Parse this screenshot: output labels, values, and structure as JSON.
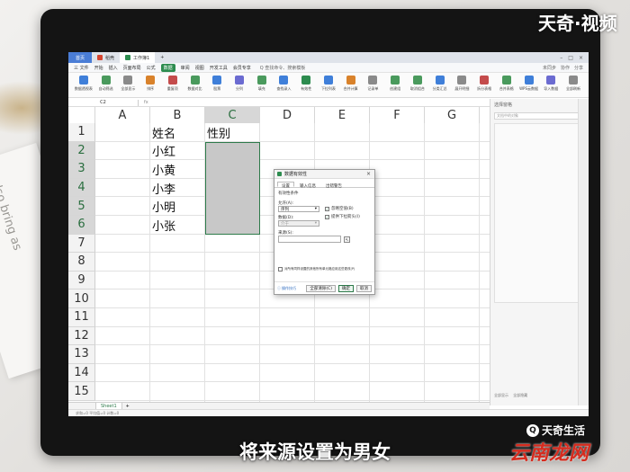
{
  "watermark": "天奇·视频",
  "subtitle": "将来源设置为男女",
  "brand_small": "天奇生活",
  "brand_small_logo": "Q",
  "brand_large": "云南龙网",
  "background_book_text": "also bring as",
  "tabs": {
    "home": "首页",
    "items": [
      "稻壳",
      "工作簿1"
    ],
    "add": "+"
  },
  "menu": {
    "file": "三 文件",
    "items": [
      "开始",
      "插入",
      "页面布局",
      "公式",
      "数据",
      "审阅",
      "视图",
      "开发工具",
      "会员专享"
    ],
    "active": "数据",
    "search": "Q 查找命令、搜索模板",
    "right": [
      "未同步",
      "协作",
      "分享"
    ]
  },
  "ribbon": [
    {
      "label": "数据透视表",
      "color": "#3f7fd9"
    },
    {
      "label": "自动筛选",
      "color": "#4a9a5d"
    },
    {
      "label": "全部显示",
      "color": "#8a8a8a"
    },
    {
      "label": "排序",
      "color": "#d9822b"
    },
    {
      "label": "重复项",
      "color": "#c44b4b"
    },
    {
      "label": "数据对比",
      "color": "#4a9a5d"
    },
    {
      "label": "股票",
      "color": "#3f7fd9"
    },
    {
      "label": "分列",
      "color": "#6b6bd1"
    },
    {
      "label": "填充",
      "color": "#4a9a5d"
    },
    {
      "label": "查找录入",
      "color": "#3f7fd9"
    },
    {
      "label": "有效性",
      "color": "#2d8c4f"
    },
    {
      "label": "下拉列表",
      "color": "#3f7fd9"
    },
    {
      "label": "合并计算",
      "color": "#d9822b"
    },
    {
      "label": "记录单",
      "color": "#8a8a8a"
    },
    {
      "label": "创建组",
      "color": "#4a9a5d"
    },
    {
      "label": "取消组合",
      "color": "#4a9a5d"
    },
    {
      "label": "分类汇总",
      "color": "#3f7fd9"
    },
    {
      "label": "展开明细",
      "color": "#8a8a8a"
    },
    {
      "label": "拆分表格",
      "color": "#c44b4b"
    },
    {
      "label": "合并表格",
      "color": "#4a9a5d"
    },
    {
      "label": "WPS云数据",
      "color": "#3f7fd9"
    },
    {
      "label": "导入数据",
      "color": "#6b6bd1"
    },
    {
      "label": "全部刷新",
      "color": "#8a8a8a"
    }
  ],
  "formula": {
    "namebox": "C2",
    "fx": "fx"
  },
  "columns": [
    "A",
    "B",
    "C",
    "D",
    "E",
    "F",
    "G"
  ],
  "rows": [
    "1",
    "2",
    "3",
    "4",
    "5",
    "6",
    "7",
    "8",
    "9",
    "10",
    "11",
    "12",
    "13",
    "14",
    "15"
  ],
  "cells": {
    "B1": "姓名",
    "C1": "性别",
    "B2": "小红",
    "B3": "小黄",
    "B4": "小李",
    "B5": "小明",
    "B6": "小张"
  },
  "selected_column": "C",
  "selected_rows": [
    "2",
    "3",
    "4",
    "5",
    "6"
  ],
  "taskpane": {
    "title": "选择窗格",
    "search_placeholder": "文档中的对象",
    "footer_1": "全部显示",
    "footer_2": "全部隐藏"
  },
  "sheetbar": {
    "tab": "Sheet1",
    "add": "+"
  },
  "statusbar": {
    "text": "求和=0  平均值=0  计数=0"
  },
  "dialog": {
    "title": "数据有效性",
    "close": "×",
    "tabs": [
      "设置",
      "输入信息",
      "出错警告"
    ],
    "active_tab": "设置",
    "section": "有效性条件",
    "allow_label": "允许(A):",
    "allow_value": "序列",
    "data_label": "数据(D):",
    "data_value": "介于",
    "ignore_blank": "忽略空值(B)",
    "dropdown_arrow": "提供下拉箭头(I)",
    "source_label": "来源(S):",
    "source_value": "",
    "apply_all": "对所有同样设置的其他所有单元格应用这些更改(P)",
    "tips_link": "操作技巧",
    "clear_all": "全部清除(C)",
    "ok": "确定",
    "cancel": "取消"
  }
}
